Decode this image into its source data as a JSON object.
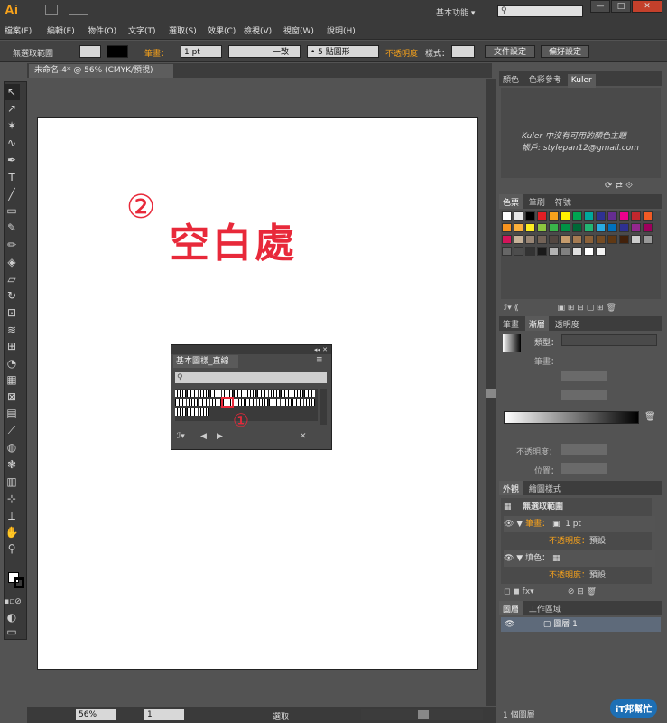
{
  "app": {
    "logo": "Ai",
    "workspace": "基本功能",
    "workspace_arrow": "▾",
    "search_placeholder": ""
  },
  "menu": [
    "檔案(F)",
    "編輯(E)",
    "物件(O)",
    "文字(T)",
    "選取(S)",
    "效果(C)",
    "檢視(V)",
    "視窗(W)",
    "說明(H)"
  ],
  "control": {
    "selection": "無選取範圍",
    "stroke_label": "筆畫：",
    "stroke_value": "1 pt",
    "uniform": "一致",
    "brush": "5 點圓形",
    "opacity": "不透明度",
    "style": "樣式：",
    "doc_setup": "文件設定",
    "prefs": "偏好設定"
  },
  "document": {
    "tab": "未命名-4* @ 56% (CMYK/預視)",
    "annotation_num": "②",
    "annotation_text": "空白處"
  },
  "float_panel": {
    "title": "基本圖樣_直線",
    "marker": "①"
  },
  "kuler": {
    "tabs": [
      "顏色",
      "色彩參考",
      "Kuler"
    ],
    "message": "Kuler 中沒有可用的顏色主題",
    "account": "帳戶: stylepan12@gmail.com"
  },
  "swatches": {
    "tabs": [
      "色票",
      "筆刷",
      "符號"
    ]
  },
  "gradient": {
    "tabs": [
      "筆畫",
      "漸層",
      "透明度"
    ],
    "type_label": "類型：",
    "stroke_label": "筆畫：",
    "opacity_label": "不透明度：",
    "position_label": "位置："
  },
  "appearance": {
    "tabs": [
      "外觀",
      "繪圖樣式"
    ],
    "title": "無選取範圍",
    "stroke": "筆畫：",
    "stroke_val": "1 pt",
    "opacity": "不透明度：",
    "opacity_val": "預設",
    "fill": "填色：",
    "opacity2": "不透明度：",
    "opacity2_val": "預設"
  },
  "layers": {
    "tabs": [
      "圖層",
      "工作區域"
    ],
    "layer_name": "圖層 1",
    "count": "1 個圖層"
  },
  "status": {
    "zoom": "56%",
    "page": "1",
    "mode": "選取"
  },
  "watermark": "iT邦幫忙",
  "colors": {
    "accent": "#f7a21b",
    "annotation": "#e8293a"
  }
}
